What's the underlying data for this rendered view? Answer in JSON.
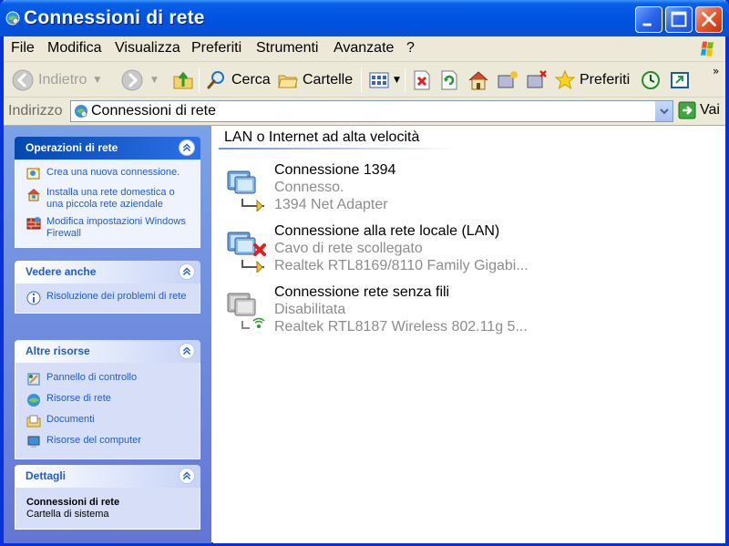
{
  "window": {
    "title": "Connessioni di rete",
    "accent": "#0054e3"
  },
  "menu": {
    "items": [
      "File",
      "Modifica",
      "Visualizza",
      "Preferiti",
      "Strumenti",
      "Avanzate",
      "?"
    ]
  },
  "toolbar": {
    "back_label": "Indietro",
    "search_label": "Cerca",
    "folders_label": "Cartelle",
    "favorites_label": "Preferiti"
  },
  "address": {
    "label": "Indirizzo",
    "value": "Connessioni di rete",
    "go_label": "Vai"
  },
  "taskpane": {
    "network_tasks": {
      "title": "Operazioni di rete",
      "links": [
        {
          "text": "Crea una nuova connessione.",
          "icon": "new-connection-icon"
        },
        {
          "text": "Installa una rete domestica o una piccola rete aziendale",
          "icon": "home-network-icon"
        },
        {
          "text": "Modifica impostazioni Windows Firewall",
          "icon": "firewall-icon"
        }
      ]
    },
    "see_also": {
      "title": "Vedere anche",
      "links": [
        {
          "text": "Risoluzione dei problemi di rete",
          "icon": "info-icon"
        }
      ]
    },
    "other_places": {
      "title": "Altre risorse",
      "links": [
        {
          "text": "Pannello di controllo",
          "icon": "control-panel-icon"
        },
        {
          "text": "Risorse di rete",
          "icon": "network-places-icon"
        },
        {
          "text": "Documenti",
          "icon": "documents-icon"
        },
        {
          "text": "Risorse del computer",
          "icon": "my-computer-icon"
        }
      ]
    },
    "details": {
      "title": "Dettagli",
      "name": "Connessioni di rete",
      "type": "Cartella di sistema"
    }
  },
  "filelist": {
    "group_title": "LAN o Internet ad alta velocità",
    "connections": [
      {
        "name": "Connessione 1394",
        "status": "Connesso.",
        "device": "1394 Net Adapter",
        "state": "connected"
      },
      {
        "name": "Connessione alla rete locale (LAN)",
        "status": "Cavo di rete scollegato",
        "device": "Realtek RTL8169/8110 Family Gigabi...",
        "state": "unplugged"
      },
      {
        "name": "Connessione rete senza fili",
        "status": "Disabilitata",
        "device": "Realtek RTL8187 Wireless 802.11g 5...",
        "state": "disabled"
      }
    ]
  }
}
